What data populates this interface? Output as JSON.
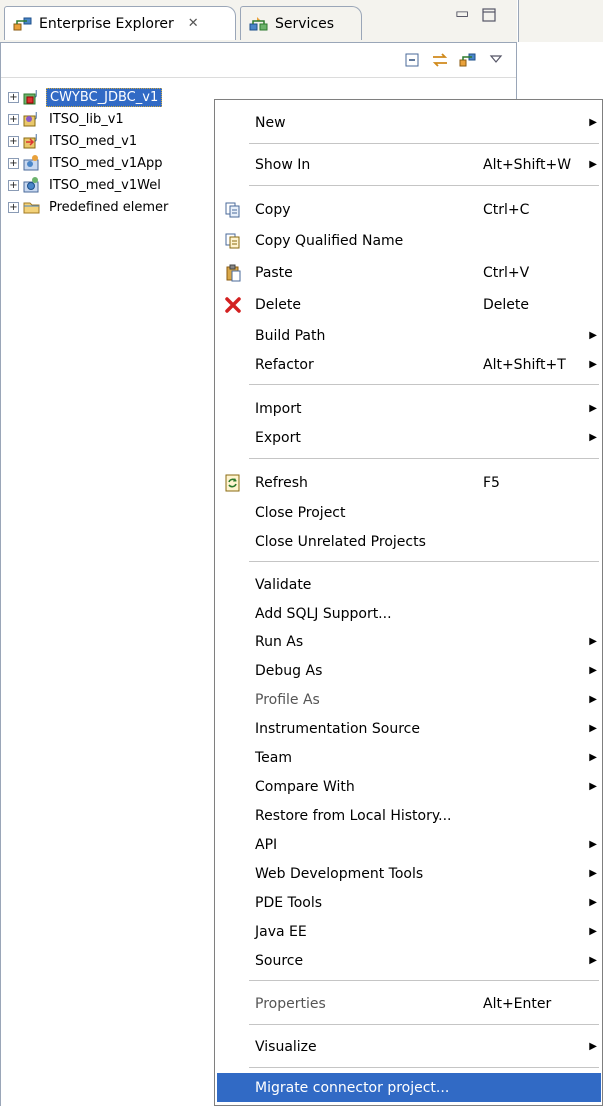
{
  "tabs": {
    "active_label": "Enterprise Explorer",
    "close_glyph": "✕",
    "inactive_label": "Services"
  },
  "tree": [
    {
      "label": "CWYBC_JDBC_v1",
      "icon": "connector-project-icon",
      "expander": "+",
      "selected": true
    },
    {
      "label": "ITSO_lib_v1",
      "icon": "library-project-icon",
      "expander": "+"
    },
    {
      "label": "ITSO_med_v1",
      "icon": "mediation-project-icon",
      "expander": "+"
    },
    {
      "label": "ITSO_med_v1App",
      "icon": "ear-project-icon",
      "expander": "+"
    },
    {
      "label": "ITSO_med_v1Wel",
      "icon": "web-project-icon",
      "expander": "+"
    },
    {
      "label": "Predefined elemer",
      "icon": "folder-icon",
      "expander": "+"
    }
  ],
  "menu": {
    "items": [
      {
        "label": "New",
        "shortcut": "",
        "submenu": true,
        "icon": ""
      },
      {
        "label": "Show In",
        "shortcut": "Alt+Shift+W",
        "submenu": true,
        "icon": ""
      },
      {
        "label": "Copy",
        "shortcut": "Ctrl+C",
        "submenu": false,
        "icon": "copy-icon"
      },
      {
        "label": "Copy Qualified Name",
        "shortcut": "",
        "submenu": false,
        "icon": "copy-qualified-icon"
      },
      {
        "label": "Paste",
        "shortcut": "Ctrl+V",
        "submenu": false,
        "icon": "paste-icon"
      },
      {
        "label": "Delete",
        "shortcut": "Delete",
        "submenu": false,
        "icon": "delete-icon"
      },
      {
        "label": "Build Path",
        "shortcut": "",
        "submenu": true,
        "icon": ""
      },
      {
        "label": "Refactor",
        "shortcut": "Alt+Shift+T",
        "submenu": true,
        "icon": ""
      },
      {
        "label": "Import",
        "shortcut": "",
        "submenu": true,
        "icon": ""
      },
      {
        "label": "Export",
        "shortcut": "",
        "submenu": true,
        "icon": ""
      },
      {
        "label": "Refresh",
        "shortcut": "F5",
        "submenu": false,
        "icon": "refresh-icon"
      },
      {
        "label": "Close Project",
        "shortcut": "",
        "submenu": false,
        "icon": ""
      },
      {
        "label": "Close Unrelated Projects",
        "shortcut": "",
        "submenu": false,
        "icon": ""
      },
      {
        "label": "Validate",
        "shortcut": "",
        "submenu": false,
        "icon": ""
      },
      {
        "label": "Add SQLJ Support...",
        "shortcut": "",
        "submenu": false,
        "icon": ""
      },
      {
        "label": "Run As",
        "shortcut": "",
        "submenu": true,
        "icon": ""
      },
      {
        "label": "Debug As",
        "shortcut": "",
        "submenu": true,
        "icon": ""
      },
      {
        "label": "Profile As",
        "shortcut": "",
        "submenu": true,
        "icon": ""
      },
      {
        "label": "Instrumentation Source",
        "shortcut": "",
        "submenu": true,
        "icon": ""
      },
      {
        "label": "Team",
        "shortcut": "",
        "submenu": true,
        "icon": ""
      },
      {
        "label": "Compare With",
        "shortcut": "",
        "submenu": true,
        "icon": ""
      },
      {
        "label": "Restore from Local History...",
        "shortcut": "",
        "submenu": false,
        "icon": ""
      },
      {
        "label": "API",
        "shortcut": "",
        "submenu": true,
        "icon": ""
      },
      {
        "label": "Web Development Tools",
        "shortcut": "",
        "submenu": true,
        "icon": ""
      },
      {
        "label": "PDE Tools",
        "shortcut": "",
        "submenu": true,
        "icon": ""
      },
      {
        "label": "Java EE",
        "shortcut": "",
        "submenu": true,
        "icon": ""
      },
      {
        "label": "Source",
        "shortcut": "",
        "submenu": true,
        "icon": ""
      },
      {
        "label": "Properties",
        "shortcut": "Alt+Enter",
        "submenu": false,
        "icon": ""
      },
      {
        "label": "Visualize",
        "shortcut": "",
        "submenu": true,
        "icon": ""
      },
      {
        "label": "Migrate connector project...",
        "shortcut": "",
        "submenu": false,
        "icon": "",
        "highlighted": true
      }
    ],
    "submenu_glyph": "▶"
  },
  "colors": {
    "selection": "#316ac5",
    "frame_border": "#9aa6b8",
    "tab_background": "#f4f3ee"
  }
}
